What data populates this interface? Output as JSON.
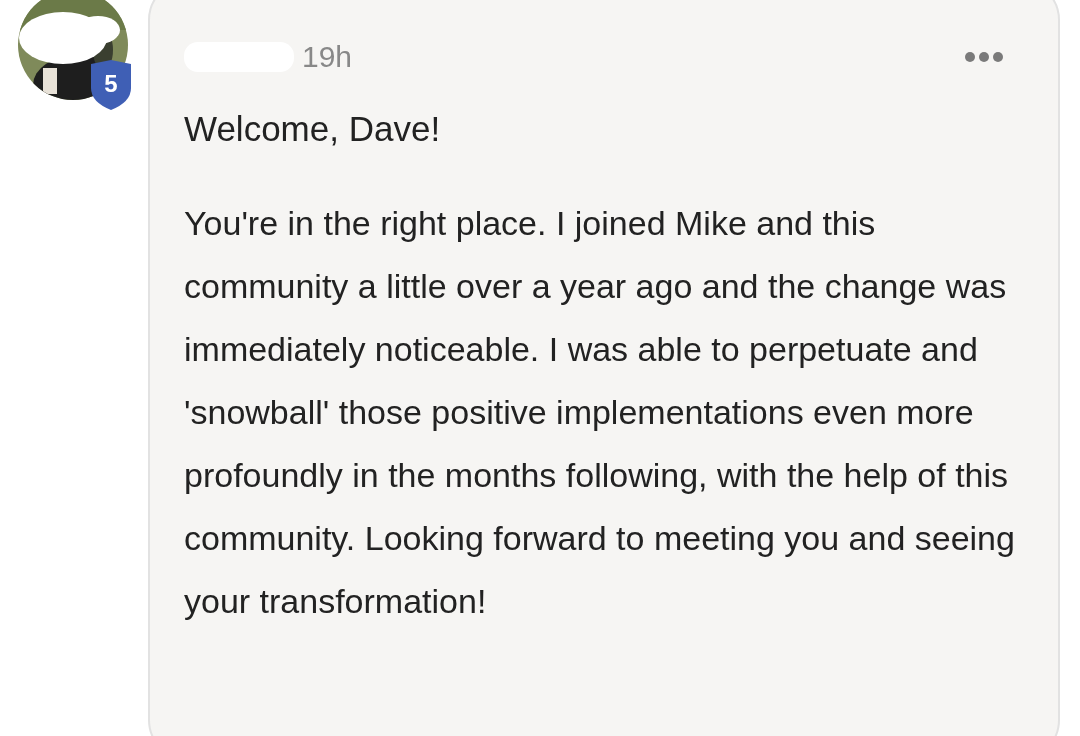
{
  "comment": {
    "author_level": "5",
    "time": "19h",
    "greeting": "Welcome, Dave!",
    "body": "You're in the right place. I joined Mike and this community a little over a year ago and the change was immediately noticeable. I was able to perpetuate and 'snowball' those positive implementations even more profoundly in the months following, with the help of this community. Looking forward to meeting you and seeing your transformation!"
  }
}
